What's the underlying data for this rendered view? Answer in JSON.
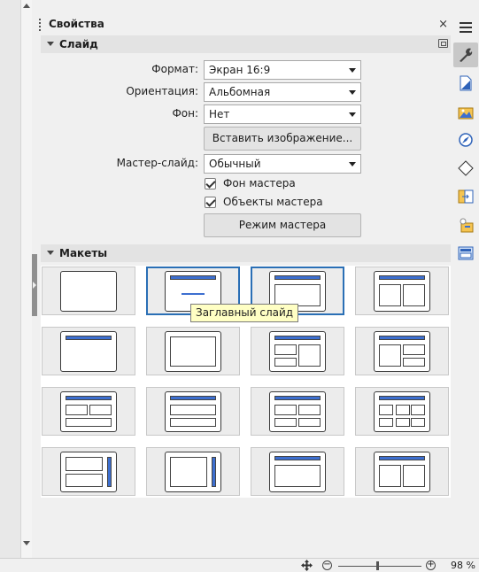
{
  "deck": {
    "title": "Свойства",
    "close_glyph": "×"
  },
  "slide_section": {
    "title": "Слайд",
    "format_label": "Формат:",
    "format_value": "Экран 16:9",
    "orientation_label": "Ориентация:",
    "orientation_value": "Альбомная",
    "background_label": "Фон:",
    "background_value": "Нет",
    "insert_image_button": "Вставить изображение...",
    "master_slide_label": "Мастер-слайд:",
    "master_slide_value": "Обычный",
    "master_background_label": "Фон мастера",
    "master_background_checked": true,
    "master_objects_label": "Объекты мастера",
    "master_objects_checked": true,
    "master_mode_button": "Режим мастера"
  },
  "layouts_section": {
    "title": "Макеты",
    "tooltip": "Заглавный слайд",
    "items": [
      {
        "name": "blank",
        "selected": false
      },
      {
        "name": "title-slide",
        "selected": true
      },
      {
        "name": "title-content",
        "selected": true
      },
      {
        "name": "title-2-content",
        "selected": false
      },
      {
        "name": "title-only",
        "selected": false
      },
      {
        "name": "centered-text",
        "selected": false
      },
      {
        "name": "title-2content-and-content",
        "selected": false
      },
      {
        "name": "title-content-and-2content",
        "selected": false
      },
      {
        "name": "title-2content-over-content",
        "selected": false
      },
      {
        "name": "title-content-over-content",
        "selected": false
      },
      {
        "name": "title-4-content",
        "selected": false
      },
      {
        "name": "title-6-content",
        "selected": false
      },
      {
        "name": "vertical-title-text-chart",
        "selected": false
      },
      {
        "name": "vertical-title-vertical-text",
        "selected": false
      },
      {
        "name": "title-vertical-text",
        "selected": false
      },
      {
        "name": "title-vertical-text-clipart",
        "selected": false
      }
    ]
  },
  "tabbar": {
    "items": [
      "menu-icon",
      "properties-icon",
      "slide-transition-icon",
      "gallery-icon",
      "navigator-icon",
      "shapes-icon",
      "master-slides-icon",
      "animation-icon",
      "slide-layouts-icon"
    ],
    "accent": "#3d6fd0"
  },
  "statusbar": {
    "zoom_value": "98 %",
    "zoom_minus": "−",
    "zoom_plus": "+"
  }
}
